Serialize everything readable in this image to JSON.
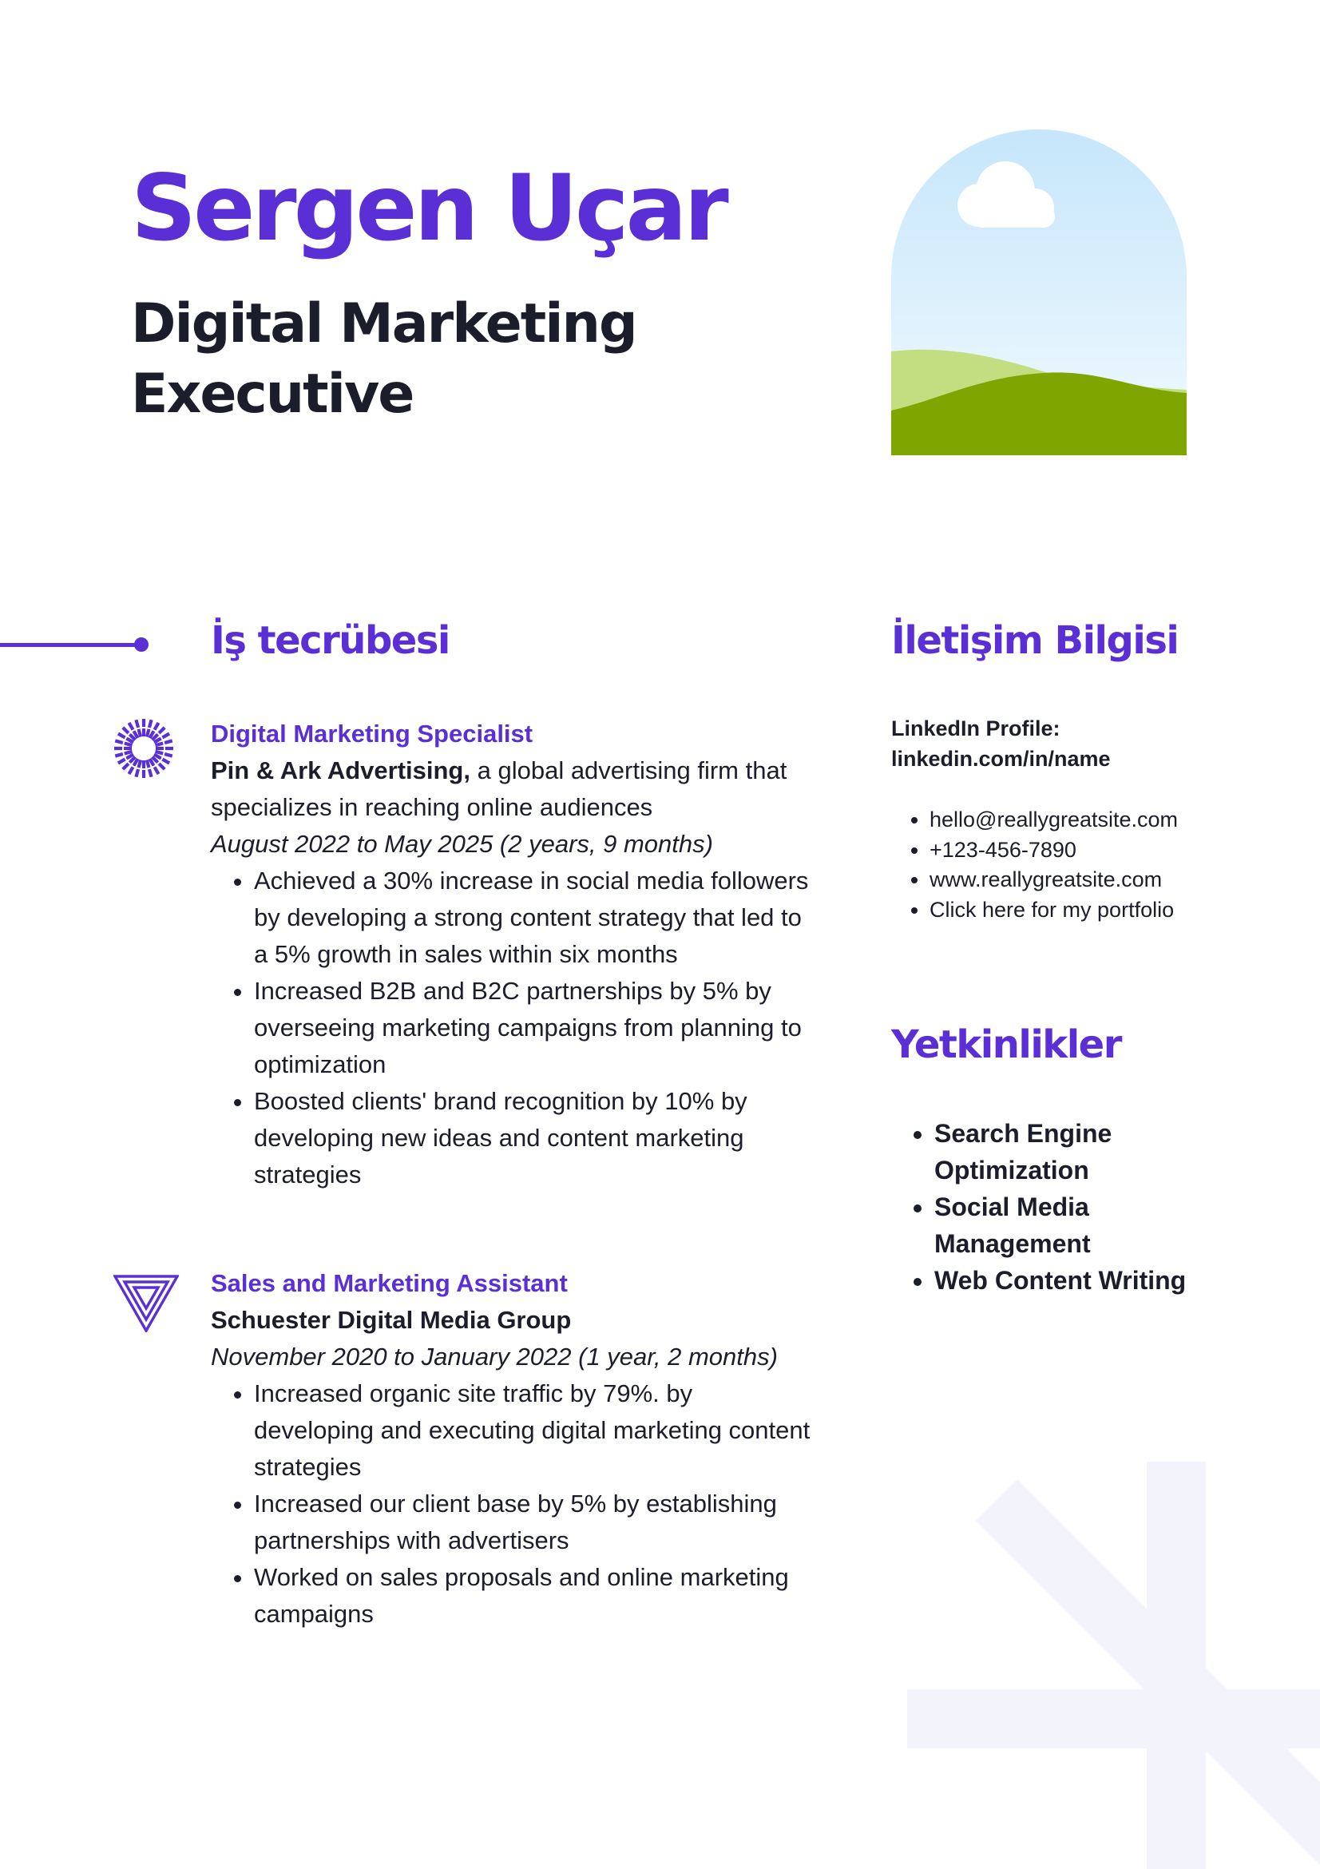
{
  "header": {
    "name": "Sergen Uçar",
    "title": "Digital Marketing Executive"
  },
  "sections": {
    "experience_heading": "İş tecrübesi",
    "contact_heading": "İletişim Bilgisi",
    "skills_heading": "Yetkinlikler"
  },
  "experience": [
    {
      "icon": "sunburst-icon",
      "role": "Digital Marketing Specialist",
      "company": "Pin & Ark Advertising,",
      "company_desc": " a global advertising firm that specializes in reaching online audiences",
      "period": "August 2022 to May 2025 (2 years, 9 months)",
      "bullets": [
        "Achieved a 30% increase in social media followers by developing a strong content strategy that led to a 5% growth in sales within six months",
        "Increased B2B and B2C partnerships by 5% by overseeing marketing campaigns from planning to optimization",
        "Boosted clients' brand recognition by 10% by developing new ideas and content marketing strategies"
      ]
    },
    {
      "icon": "triangle-icon",
      "role": "Sales and Marketing Assistant",
      "company": "Schuester Digital Media Group",
      "company_desc": "",
      "period": "November 2020 to January 2022 (1 year, 2 months)",
      "bullets": [
        "Increased organic site traffic by 79%. by developing and executing digital marketing content strategies",
        "Increased our client base by 5% by establishing partnerships with advertisers",
        "Worked on sales proposals and online marketing campaigns"
      ]
    }
  ],
  "contact": {
    "linkedin_label": "LinkedIn Profile:",
    "linkedin_url": "linkedin.com/in/name",
    "items": [
      "hello@reallygreatsite.com",
      "+123-456-7890",
      "www.reallygreatsite.com",
      "Click here for my portfolio"
    ]
  },
  "skills": [
    "Search Engine Optimization",
    "Social Media Management",
    "Web Content Writing"
  ],
  "colors": {
    "accent": "#5a2fd6",
    "text": "#1b1d2a",
    "sky_top": "#c9e8fb",
    "hill_light": "#c3de81",
    "hill_dark": "#7fa600",
    "decor": "#f3f3fb"
  }
}
